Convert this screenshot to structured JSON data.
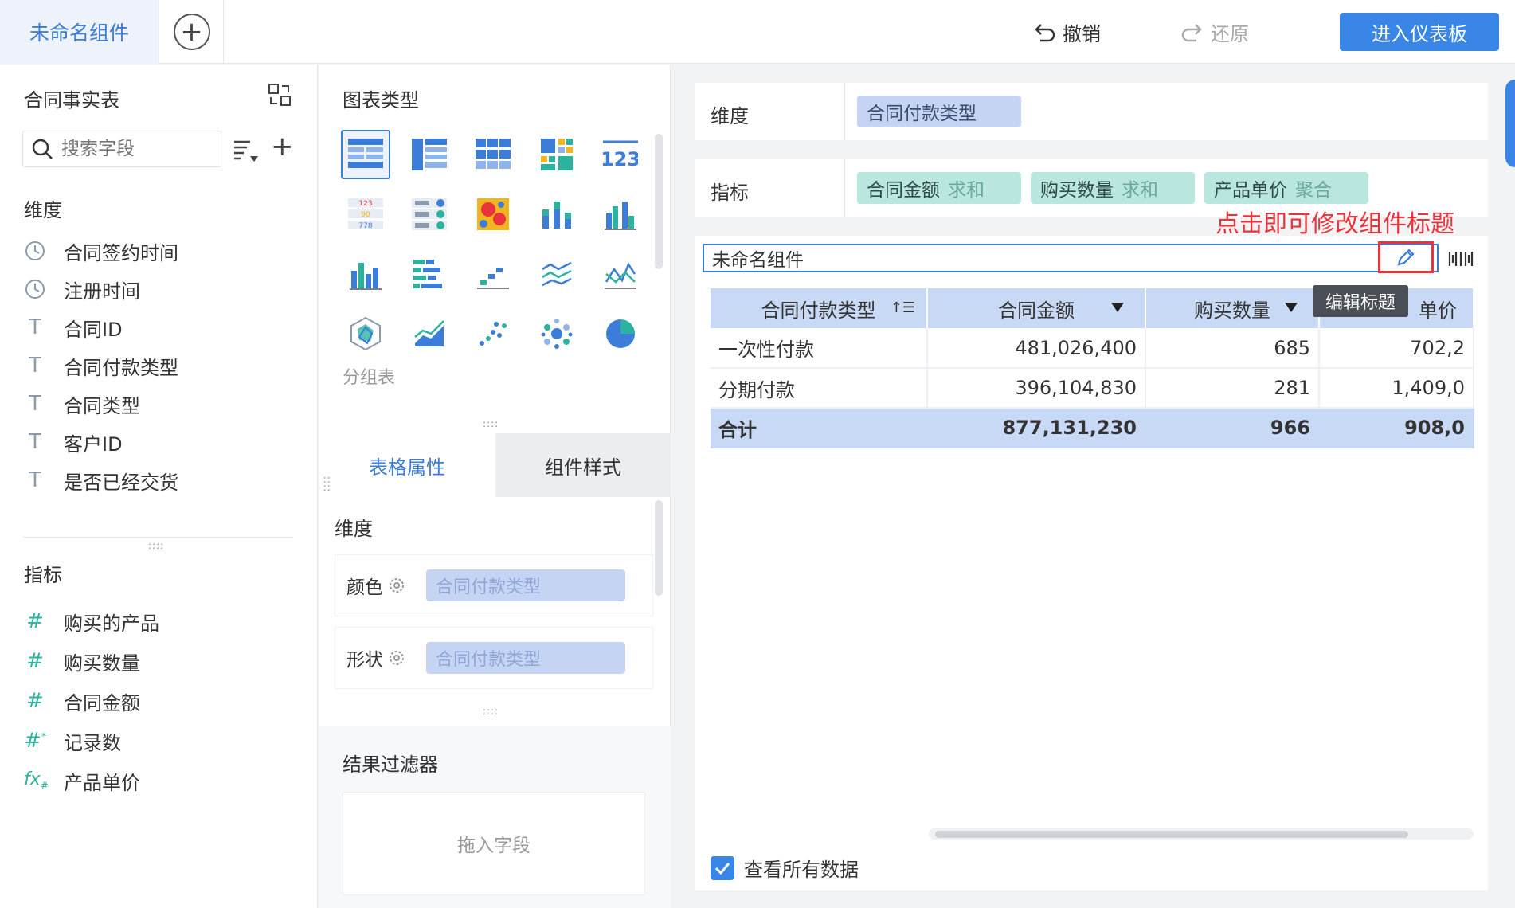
{
  "topbar": {
    "active_tab": "未命名组件",
    "undo_label": "撤销",
    "redo_label": "还原",
    "enter_dashboard_label": "进入仪表板"
  },
  "left_panel": {
    "dataset_title": "合同事实表",
    "search_placeholder": "搜索字段",
    "dimension_label": "维度",
    "dimension_fields": [
      {
        "icon": "clock-icon",
        "label": "合同签约时间"
      },
      {
        "icon": "clock-icon",
        "label": "注册时间"
      },
      {
        "icon": "text-icon",
        "label": "合同ID"
      },
      {
        "icon": "text-icon",
        "label": "合同付款类型"
      },
      {
        "icon": "text-icon",
        "label": "合同类型"
      },
      {
        "icon": "text-icon",
        "label": "客户ID"
      },
      {
        "icon": "text-icon",
        "label": "是否已经交货"
      }
    ],
    "measure_label": "指标",
    "measure_fields": [
      {
        "icon": "hash-icon",
        "label": "购买的产品"
      },
      {
        "icon": "hash-icon",
        "label": "购买数量"
      },
      {
        "icon": "hash-icon",
        "label": "合同金额"
      },
      {
        "icon": "hash-star-icon",
        "label": "记录数"
      },
      {
        "icon": "fx-icon",
        "label": "产品单价"
      }
    ]
  },
  "middle_panel": {
    "chart_type_title": "图表类型",
    "selected_chart_label": "分组表",
    "tabs": {
      "table_props": "表格属性",
      "component_style": "组件样式"
    },
    "dimension_label": "维度",
    "color_label": "颜色",
    "color_value": "合同付款类型",
    "shape_label": "形状",
    "shape_value": "合同付款类型",
    "filter_title": "结果过滤器",
    "drop_hint": "拖入字段"
  },
  "right_panel": {
    "dimension_shelf_label": "维度",
    "dimension_pill": "合同付款类型",
    "measure_shelf_label": "指标",
    "measure_pills": [
      {
        "name": "合同金额",
        "agg": "求和"
      },
      {
        "name": "购买数量",
        "agg": "求和"
      },
      {
        "name": "产品单价",
        "agg": "聚合"
      }
    ],
    "annotation": "点击即可修改组件标题",
    "component_title": "未命名组件",
    "tooltip": "编辑标题",
    "table": {
      "headers": [
        "合同付款类型",
        "合同金额",
        "购买数量",
        "单价"
      ],
      "rows": [
        [
          "一次性付款",
          "481,026,400",
          "685",
          "702,2"
        ],
        [
          "分期付款",
          "396,104,830",
          "281",
          "1,409,0"
        ]
      ],
      "total": [
        "合计",
        "877,131,230",
        "966",
        "908,0"
      ]
    },
    "view_all_label": "查看所有数据"
  },
  "colors": {
    "accent": "#3a86e6",
    "dimension_pill": "#c5d4f3",
    "measure_pill": "#b9e6de",
    "annotation": "#e8343a"
  }
}
